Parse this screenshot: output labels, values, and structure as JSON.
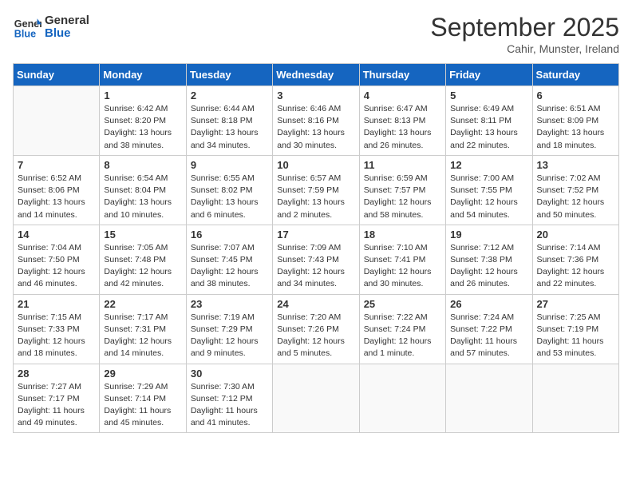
{
  "header": {
    "logo_general": "General",
    "logo_blue": "Blue",
    "month_title": "September 2025",
    "location": "Cahir, Munster, Ireland"
  },
  "days_of_week": [
    "Sunday",
    "Monday",
    "Tuesday",
    "Wednesday",
    "Thursday",
    "Friday",
    "Saturday"
  ],
  "weeks": [
    [
      {
        "day": "",
        "info": ""
      },
      {
        "day": "1",
        "info": "Sunrise: 6:42 AM\nSunset: 8:20 PM\nDaylight: 13 hours\nand 38 minutes."
      },
      {
        "day": "2",
        "info": "Sunrise: 6:44 AM\nSunset: 8:18 PM\nDaylight: 13 hours\nand 34 minutes."
      },
      {
        "day": "3",
        "info": "Sunrise: 6:46 AM\nSunset: 8:16 PM\nDaylight: 13 hours\nand 30 minutes."
      },
      {
        "day": "4",
        "info": "Sunrise: 6:47 AM\nSunset: 8:13 PM\nDaylight: 13 hours\nand 26 minutes."
      },
      {
        "day": "5",
        "info": "Sunrise: 6:49 AM\nSunset: 8:11 PM\nDaylight: 13 hours\nand 22 minutes."
      },
      {
        "day": "6",
        "info": "Sunrise: 6:51 AM\nSunset: 8:09 PM\nDaylight: 13 hours\nand 18 minutes."
      }
    ],
    [
      {
        "day": "7",
        "info": "Sunrise: 6:52 AM\nSunset: 8:06 PM\nDaylight: 13 hours\nand 14 minutes."
      },
      {
        "day": "8",
        "info": "Sunrise: 6:54 AM\nSunset: 8:04 PM\nDaylight: 13 hours\nand 10 minutes."
      },
      {
        "day": "9",
        "info": "Sunrise: 6:55 AM\nSunset: 8:02 PM\nDaylight: 13 hours\nand 6 minutes."
      },
      {
        "day": "10",
        "info": "Sunrise: 6:57 AM\nSunset: 7:59 PM\nDaylight: 13 hours\nand 2 minutes."
      },
      {
        "day": "11",
        "info": "Sunrise: 6:59 AM\nSunset: 7:57 PM\nDaylight: 12 hours\nand 58 minutes."
      },
      {
        "day": "12",
        "info": "Sunrise: 7:00 AM\nSunset: 7:55 PM\nDaylight: 12 hours\nand 54 minutes."
      },
      {
        "day": "13",
        "info": "Sunrise: 7:02 AM\nSunset: 7:52 PM\nDaylight: 12 hours\nand 50 minutes."
      }
    ],
    [
      {
        "day": "14",
        "info": "Sunrise: 7:04 AM\nSunset: 7:50 PM\nDaylight: 12 hours\nand 46 minutes."
      },
      {
        "day": "15",
        "info": "Sunrise: 7:05 AM\nSunset: 7:48 PM\nDaylight: 12 hours\nand 42 minutes."
      },
      {
        "day": "16",
        "info": "Sunrise: 7:07 AM\nSunset: 7:45 PM\nDaylight: 12 hours\nand 38 minutes."
      },
      {
        "day": "17",
        "info": "Sunrise: 7:09 AM\nSunset: 7:43 PM\nDaylight: 12 hours\nand 34 minutes."
      },
      {
        "day": "18",
        "info": "Sunrise: 7:10 AM\nSunset: 7:41 PM\nDaylight: 12 hours\nand 30 minutes."
      },
      {
        "day": "19",
        "info": "Sunrise: 7:12 AM\nSunset: 7:38 PM\nDaylight: 12 hours\nand 26 minutes."
      },
      {
        "day": "20",
        "info": "Sunrise: 7:14 AM\nSunset: 7:36 PM\nDaylight: 12 hours\nand 22 minutes."
      }
    ],
    [
      {
        "day": "21",
        "info": "Sunrise: 7:15 AM\nSunset: 7:33 PM\nDaylight: 12 hours\nand 18 minutes."
      },
      {
        "day": "22",
        "info": "Sunrise: 7:17 AM\nSunset: 7:31 PM\nDaylight: 12 hours\nand 14 minutes."
      },
      {
        "day": "23",
        "info": "Sunrise: 7:19 AM\nSunset: 7:29 PM\nDaylight: 12 hours\nand 9 minutes."
      },
      {
        "day": "24",
        "info": "Sunrise: 7:20 AM\nSunset: 7:26 PM\nDaylight: 12 hours\nand 5 minutes."
      },
      {
        "day": "25",
        "info": "Sunrise: 7:22 AM\nSunset: 7:24 PM\nDaylight: 12 hours\nand 1 minute."
      },
      {
        "day": "26",
        "info": "Sunrise: 7:24 AM\nSunset: 7:22 PM\nDaylight: 11 hours\nand 57 minutes."
      },
      {
        "day": "27",
        "info": "Sunrise: 7:25 AM\nSunset: 7:19 PM\nDaylight: 11 hours\nand 53 minutes."
      }
    ],
    [
      {
        "day": "28",
        "info": "Sunrise: 7:27 AM\nSunset: 7:17 PM\nDaylight: 11 hours\nand 49 minutes."
      },
      {
        "day": "29",
        "info": "Sunrise: 7:29 AM\nSunset: 7:14 PM\nDaylight: 11 hours\nand 45 minutes."
      },
      {
        "day": "30",
        "info": "Sunrise: 7:30 AM\nSunset: 7:12 PM\nDaylight: 11 hours\nand 41 minutes."
      },
      {
        "day": "",
        "info": ""
      },
      {
        "day": "",
        "info": ""
      },
      {
        "day": "",
        "info": ""
      },
      {
        "day": "",
        "info": ""
      }
    ]
  ]
}
